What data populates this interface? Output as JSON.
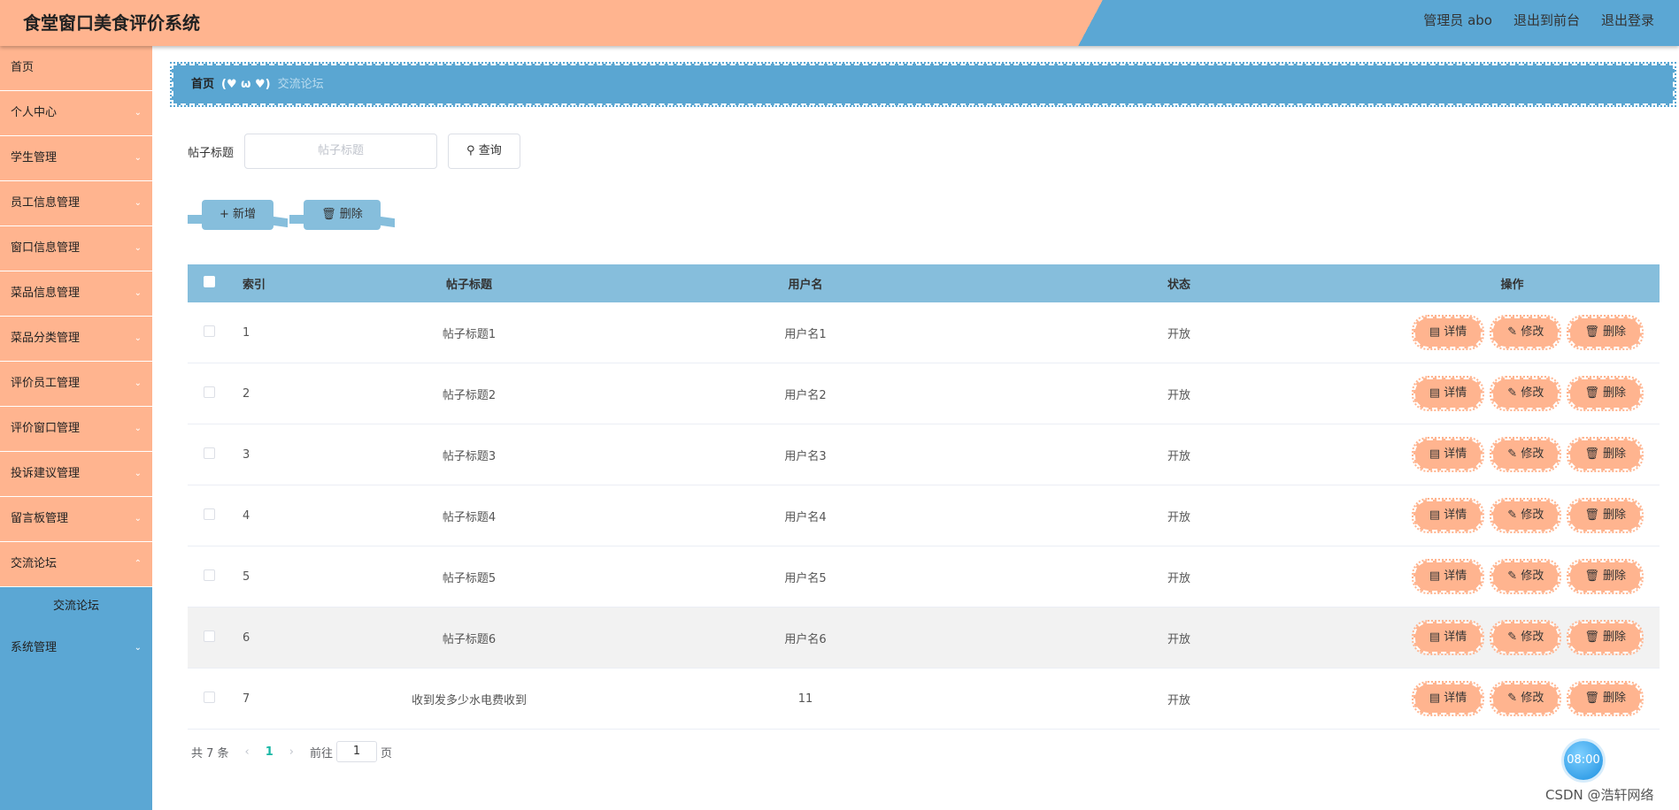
{
  "header": {
    "title": "食堂窗口美食评价系统",
    "user": "管理员 abo",
    "front_link": "退出到前台",
    "logout": "退出登录"
  },
  "sidebar": {
    "items": [
      {
        "label": "首页"
      },
      {
        "label": "个人中心"
      },
      {
        "label": "学生管理"
      },
      {
        "label": "员工信息管理"
      },
      {
        "label": "窗口信息管理"
      },
      {
        "label": "菜品信息管理"
      },
      {
        "label": "菜品分类管理"
      },
      {
        "label": "评价员工管理"
      },
      {
        "label": "评价窗口管理"
      },
      {
        "label": "投诉建议管理"
      },
      {
        "label": "留言板管理"
      },
      {
        "label": "交流论坛"
      }
    ],
    "sub_active": "交流论坛",
    "last": "系统管理"
  },
  "breadcrumb": {
    "home": "首页",
    "separator": "(♥ ω ♥)",
    "current": "交流论坛"
  },
  "search": {
    "label": "帖子标题",
    "placeholder": "帖子标题",
    "button": "查询"
  },
  "actions": {
    "add": "新增",
    "delete": "删除"
  },
  "table": {
    "headers": {
      "index": "索引",
      "title": "帖子标题",
      "user": "用户名",
      "status": "状态",
      "ops": "操作"
    },
    "ops": {
      "detail": "详情",
      "edit": "修改",
      "delete": "删除"
    },
    "rows": [
      {
        "index": "1",
        "title": "帖子标题1",
        "user": "用户名1",
        "status": "开放"
      },
      {
        "index": "2",
        "title": "帖子标题2",
        "user": "用户名2",
        "status": "开放"
      },
      {
        "index": "3",
        "title": "帖子标题3",
        "user": "用户名3",
        "status": "开放"
      },
      {
        "index": "4",
        "title": "帖子标题4",
        "user": "用户名4",
        "status": "开放"
      },
      {
        "index": "5",
        "title": "帖子标题5",
        "user": "用户名5",
        "status": "开放"
      },
      {
        "index": "6",
        "title": "帖子标题6",
        "user": "用户名6",
        "status": "开放"
      },
      {
        "index": "7",
        "title": "收到发多少水电费收到",
        "user": "11",
        "status": "开放"
      }
    ]
  },
  "pager": {
    "total": "共 7 条",
    "current": "1",
    "goto_prefix": "前往",
    "goto_value": "1",
    "goto_suffix": "页"
  },
  "clock": "08:00",
  "watermark": "CSDN @浩轩网络",
  "colors": {
    "peach": "#ffb48f",
    "blue": "#5ba7d4",
    "light_blue": "#86bedc"
  }
}
